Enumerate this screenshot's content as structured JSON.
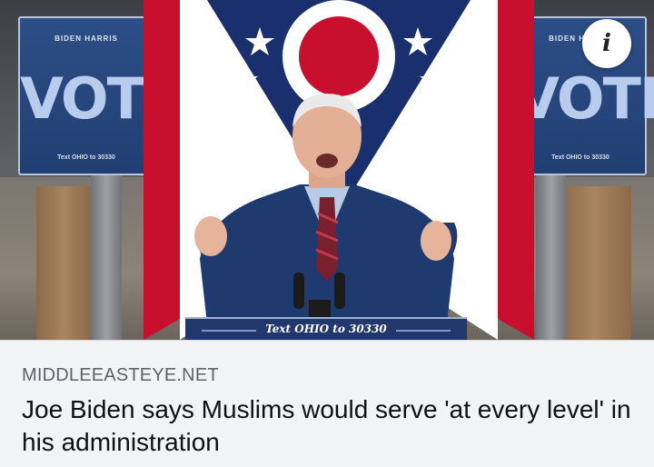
{
  "image": {
    "left_sign": {
      "top_text": "BIDEN HARRIS",
      "main_text": "VOTE",
      "sub_text": "Text OHIO to 30330"
    },
    "right_sign": {
      "top_text": "BIDEN HARRIS",
      "main_text": "VOTE",
      "sub_text": "Text OHIO to 30330"
    },
    "podium_text": "Text OHIO to 30330",
    "info_button_icon": "info-icon",
    "info_button_glyph": "i"
  },
  "link_preview": {
    "source": "MIDDLEEASTEYE.NET",
    "headline": "Joe Biden says Muslims would serve 'at every level' in his administration"
  },
  "colors": {
    "caption_background": "#f2f3f5",
    "source_text": "#5f6368",
    "headline_text": "#0f1114",
    "flag_red": "#c8102e",
    "flag_blue": "#1a2f6e"
  }
}
